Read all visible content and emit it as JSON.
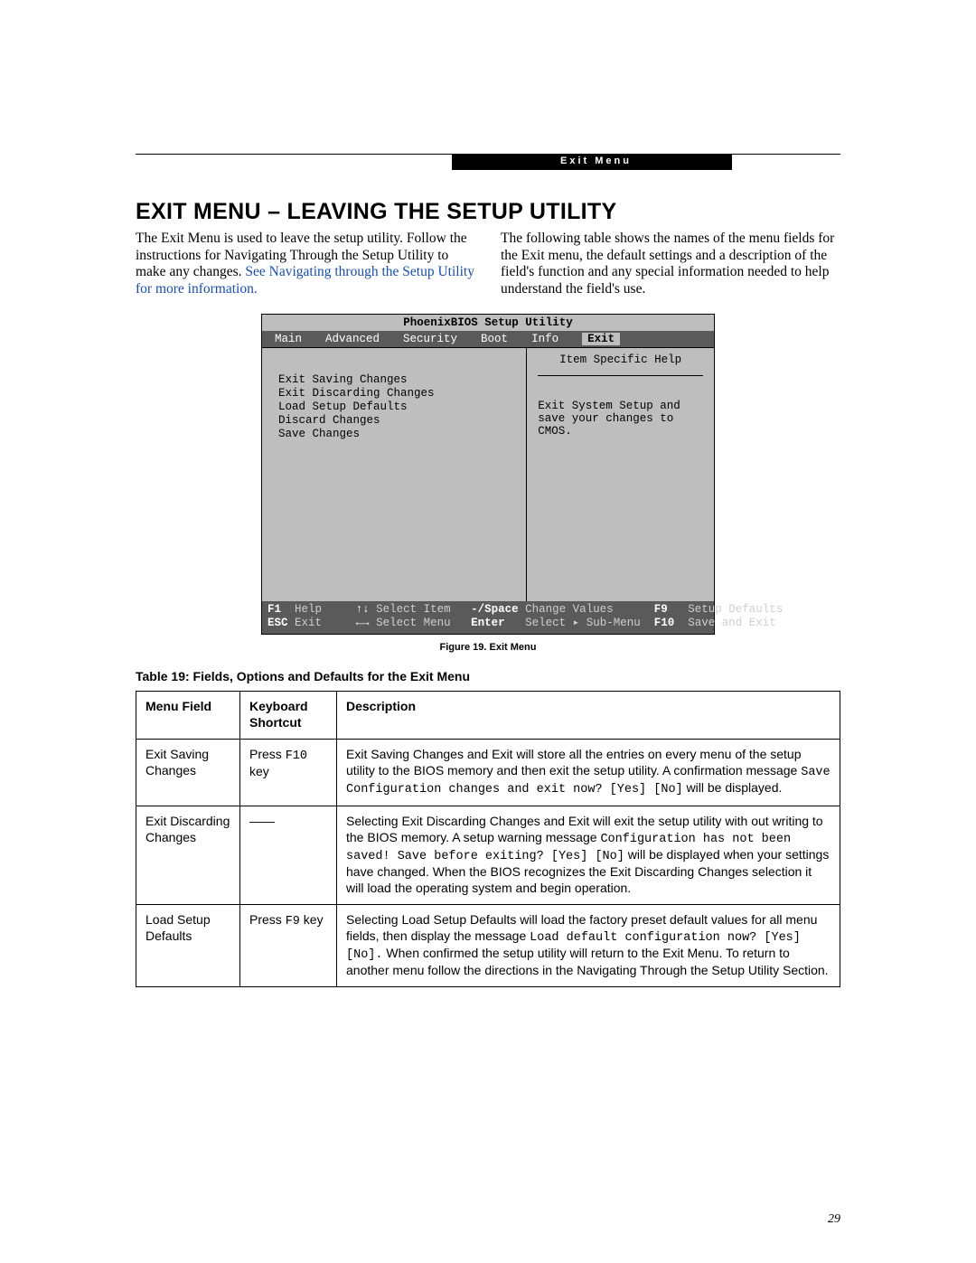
{
  "header": {
    "label": "Exit Menu"
  },
  "heading": "EXIT MENU – LEAVING THE SETUP UTILITY",
  "intro": {
    "left_a": "The Exit Menu is used to leave the setup utility. Follow the instructions for Navigating Through the Setup Utility to make any changes. ",
    "left_link": "See Navigating through the Setup Utility for more information.",
    "right": "The following table shows the names of the menu fields for the Exit menu, the default settings and a description of the field's function and any special information needed to help understand the field's use."
  },
  "bios": {
    "title": "PhoenixBIOS Setup Utility",
    "tabs": [
      "Main",
      "Advanced",
      "Security",
      "Boot",
      "Info",
      "Exit"
    ],
    "active_tab": "Exit",
    "items": [
      "Exit Saving Changes",
      "Exit Discarding Changes",
      "Load Setup Defaults",
      "Discard Changes",
      "Save Changes"
    ],
    "help_title": "Item Specific Help",
    "help_body": "Exit System Setup and save your changes to CMOS.",
    "footer": {
      "f1": "F1",
      "help": "Help",
      "updn": "↑↓",
      "sel_item": "Select Item",
      "minus": "-/Space",
      "chg": "Change Values",
      "f9": "F9",
      "defaults": "Setup Defaults",
      "esc": "ESC",
      "exit": "Exit",
      "lr": "←→",
      "sel_menu": "Select Menu",
      "enter": "Enter",
      "sub": "Select ▸ Sub-Menu",
      "f10": "F10",
      "save": "Save and Exit"
    }
  },
  "figure_caption": "Figure 19.  Exit Menu",
  "table_title": "Table 19: Fields, Options and Defaults for the Exit Menu",
  "table": {
    "headers": [
      "Menu Field",
      "Keyboard Shortcut",
      "Description"
    ],
    "rows": [
      {
        "field": "Exit Saving Changes",
        "shortcut_a": "Press ",
        "shortcut_mono": "F10",
        "shortcut_b": " key",
        "desc_a": "Exit Saving Changes and Exit will store all the entries on every menu of the setup utility to the BIOS memory and then exit the setup utility. A confirmation message ",
        "desc_mono": "Save Configuration changes and exit now? [Yes] [No]",
        "desc_b": " will be displayed."
      },
      {
        "field": "Exit Discarding Changes",
        "shortcut_a": "——",
        "shortcut_mono": "",
        "shortcut_b": "",
        "desc_a": "Selecting Exit Discarding Changes and Exit will exit the setup utility with out writing to the BIOS memory. A setup warning message ",
        "desc_mono": "Configuration has not been saved! Save before exiting? [Yes] [No]",
        "desc_b": " will be displayed when your settings have changed. When the BIOS recognizes the Exit Discarding Changes selection it will load the operating system and begin operation."
      },
      {
        "field": "Load Setup Defaults",
        "shortcut_a": "Press ",
        "shortcut_mono": "F9",
        "shortcut_b": " key",
        "desc_a": "Selecting Load Setup Defaults will load the factory preset default values for all menu fields, then display the message ",
        "desc_mono": "Load default configuration now? [Yes] [No].",
        "desc_b": " When confirmed the setup utility will return to the Exit Menu. To return to another menu follow the directions in the Navigating Through the Setup Utility Section."
      }
    ]
  },
  "page_number": "29"
}
